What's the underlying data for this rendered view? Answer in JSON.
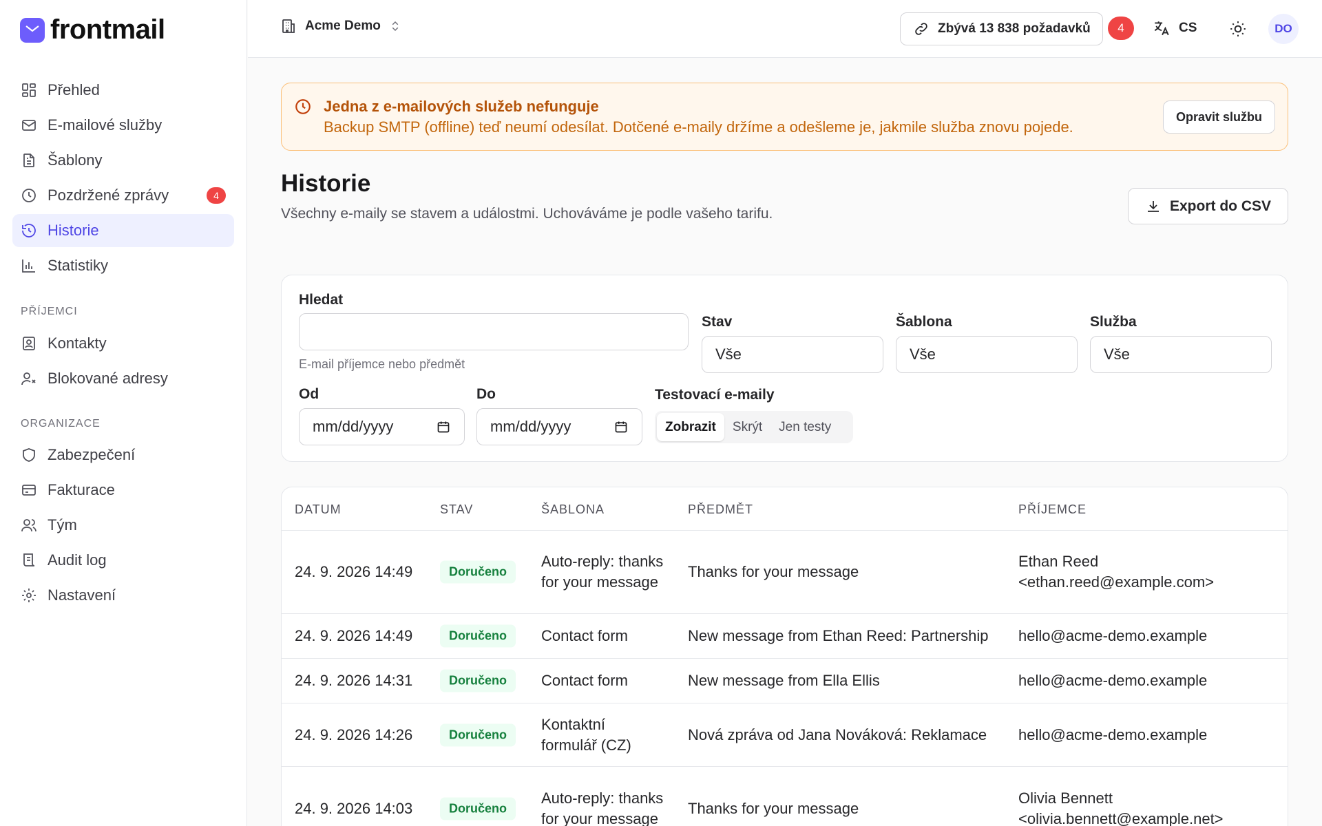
{
  "app": {
    "name": "frontmail"
  },
  "sidebar": {
    "items": [
      {
        "label": "Přehled"
      },
      {
        "label": "E-mailové služby"
      },
      {
        "label": "Šablony"
      },
      {
        "label": "Pozdržené zprávy",
        "badge": "4"
      },
      {
        "label": "Historie"
      },
      {
        "label": "Statistiky"
      }
    ],
    "recipients_label": "PŘÍJEMCI",
    "recipients": [
      {
        "label": "Kontakty"
      },
      {
        "label": "Blokované adresy"
      }
    ],
    "org_label": "ORGANIZACE",
    "org": [
      {
        "label": "Zabezpečení"
      },
      {
        "label": "Fakturace"
      },
      {
        "label": "Tým"
      },
      {
        "label": "Audit log"
      },
      {
        "label": "Nastavení"
      }
    ]
  },
  "topbar": {
    "org_name": "Acme Demo",
    "quota": "Zbývá 13 838 požadavků",
    "notifications": "4",
    "lang": "CS",
    "avatar": "DO"
  },
  "alert": {
    "title": "Jedna z e-mailových služeb nefunguje",
    "body": "Backup SMTP (offline) teď neumí odesílat. Dotčené e-maily držíme a odešleme je, jakmile služba znovu pojede.",
    "button": "Opravit službu"
  },
  "page": {
    "title": "Historie",
    "subtitle": "Všechny e-maily se stavem a událostmi. Uchováváme je podle vašeho tarifu.",
    "export": "Export do CSV"
  },
  "filters": {
    "search_label": "Hledat",
    "search_value": "",
    "search_hint": "E-mail příjemce nebo předmět",
    "status_label": "Stav",
    "status_value": "Vše",
    "template_label": "Šablona",
    "template_value": "Vše",
    "service_label": "Služba",
    "service_value": "Vše",
    "from_label": "Od",
    "from_value": "mm/dd/yyyy",
    "to_label": "Do",
    "to_value": "mm/dd/yyyy",
    "test_label": "Testovací e-maily",
    "test_options": [
      "Zobrazit",
      "Skrýt",
      "Jen testy"
    ],
    "test_selected": "Zobrazit"
  },
  "table": {
    "columns": [
      "DATUM",
      "STAV",
      "ŠABLONA",
      "PŘEDMĚT",
      "PŘÍJEMCE"
    ],
    "rows": [
      {
        "date": "24. 9. 2026 14:49",
        "status": "Doručeno",
        "template": "Auto-reply: thanks for your message",
        "subject": "Thanks for your message",
        "recipient": "Ethan Reed <ethan.reed@example.com>"
      },
      {
        "date": "24. 9. 2026 14:49",
        "status": "Doručeno",
        "template": "Contact form",
        "subject": "New message from Ethan Reed: Partnership",
        "recipient": "hello@acme-demo.example"
      },
      {
        "date": "24. 9. 2026 14:31",
        "status": "Doručeno",
        "template": "Contact form",
        "subject": "New message from Ella Ellis",
        "recipient": "hello@acme-demo.example"
      },
      {
        "date": "24. 9. 2026 14:26",
        "status": "Doručeno",
        "template": "Kontaktní formulář (CZ)",
        "subject": "Nová zpráva od Jana Nováková: Reklamace",
        "recipient": "hello@acme-demo.example"
      },
      {
        "date": "24. 9. 2026 14:03",
        "status": "Doručeno",
        "template": "Auto-reply: thanks for your message",
        "subject": "Thanks for your message",
        "recipient": "Olivia Bennett <olivia.bennett@example.net>"
      }
    ]
  },
  "colors": {
    "accent": "#4f46e5",
    "brand": "#6d5dfc",
    "danger": "#ef4444",
    "warning_bg": "#fff7ed",
    "success": "#15803d"
  }
}
